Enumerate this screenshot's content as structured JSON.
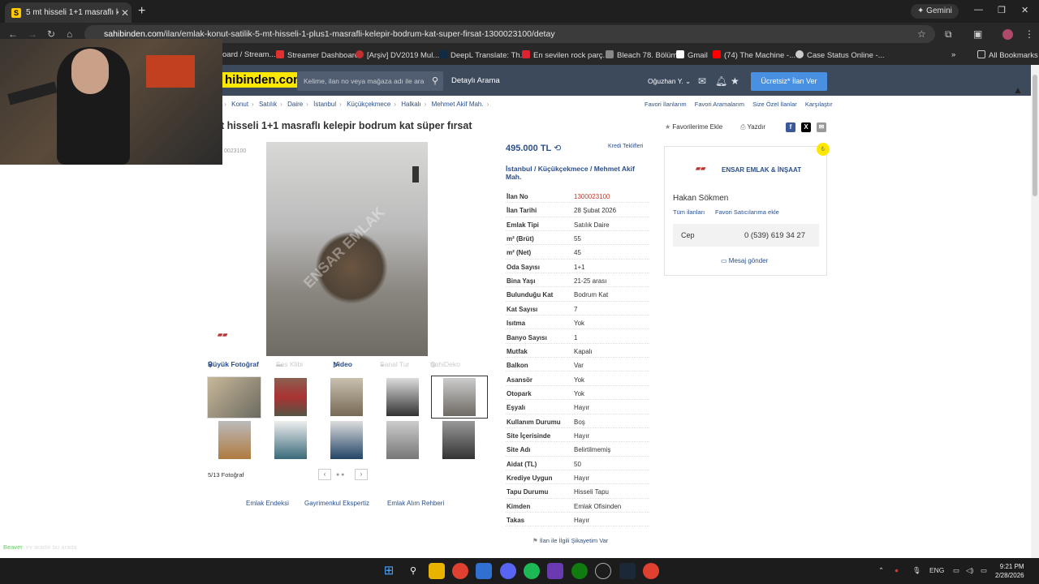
{
  "browser": {
    "tab_title": "5 mt hisseli 1+1 masraflı kelepir",
    "tab_favicon": "S",
    "gemini_label": "Gemini",
    "url_domain": "sahibinden.com",
    "url_path": "/ilan/emlak-konut-satilik-5-mt-hisseli-1-plus1-masrafli-kelepir-bodrum-kat-super-firsat-1300023100/detay",
    "bookmarks": [
      "oard / Stream...",
      "Streamer Dashboard",
      "[Arşiv] DV2019 Mul...",
      "DeepL Translate: Th...",
      "En sevilen rock parç...",
      "Bleach 78. Bölüm",
      "Gmail",
      "(74) The Machine -...",
      "Case Status Online -..."
    ],
    "all_bookmarks": "All Bookmarks"
  },
  "site": {
    "logo": "hibinden.com",
    "search_placeholder": "Kelime, ilan no veya mağaza adı ile ara",
    "detailed_search": "Detaylı Arama",
    "user_name": "Oğuzhan Y.",
    "post_ad": "Ücretsiz* İlan Ver"
  },
  "breadcrumb": [
    "t",
    "Konut",
    "Satılık",
    "Daire",
    "İstanbul",
    "Küçükçekmece",
    "Halkalı",
    "Mehmet Akif Mah."
  ],
  "top_links": [
    "Favori İlanlarım",
    "Favori Aramalarım",
    "Size Özel İlanlar",
    "Karşılaştır"
  ],
  "listing": {
    "title": "t hisseli 1+1 masraflı kelepir bodrum kat süper fırsat",
    "add_favorite": "Favorilerime Ekle",
    "print": "Yazdır",
    "id_side": "0023100",
    "price": "495.000 TL",
    "credit_offers": "Kredi Teklifleri",
    "location": [
      "İstanbul",
      "Küçükçekmece",
      "Mehmet Akif Mah."
    ],
    "details": [
      {
        "k": "İlan No",
        "v": "1300023100"
      },
      {
        "k": "İlan Tarihi",
        "v": "28 Şubat 2026"
      },
      {
        "k": "Emlak Tipi",
        "v": "Satılık Daire"
      },
      {
        "k": "m² (Brüt)",
        "v": "55"
      },
      {
        "k": "m² (Net)",
        "v": "45"
      },
      {
        "k": "Oda Sayısı",
        "v": "1+1"
      },
      {
        "k": "Bina Yaşı",
        "v": "21-25 arası"
      },
      {
        "k": "Bulunduğu Kat",
        "v": "Bodrum Kat"
      },
      {
        "k": "Kat Sayısı",
        "v": "7"
      },
      {
        "k": "Isıtma",
        "v": "Yok"
      },
      {
        "k": "Banyo Sayısı",
        "v": "1"
      },
      {
        "k": "Mutfak",
        "v": "Kapalı"
      },
      {
        "k": "Balkon",
        "v": "Var"
      },
      {
        "k": "Asansör",
        "v": "Yok"
      },
      {
        "k": "Otopark",
        "v": "Yok"
      },
      {
        "k": "Eşyalı",
        "v": "Hayır"
      },
      {
        "k": "Kullanım Durumu",
        "v": "Boş"
      },
      {
        "k": "Site İçerisinde",
        "v": "Hayır"
      },
      {
        "k": "Site Adı",
        "v": "Belirtilmemiş"
      },
      {
        "k": "Aidat (TL)",
        "v": "50"
      },
      {
        "k": "Krediye Uygun",
        "v": "Hayır"
      },
      {
        "k": "Tapu Durumu",
        "v": "Hisseli Tapu"
      },
      {
        "k": "Kimden",
        "v": "Emlak Ofisinden"
      },
      {
        "k": "Takas",
        "v": "Hayır"
      }
    ],
    "complaint": "İlan ile İlgili Şikayetim Var"
  },
  "photos": {
    "tabs": [
      "Büyük Fotoğraf",
      "Ses Klibi",
      "Video",
      "Sanal Tur",
      "SahiDeko"
    ],
    "count": "5/13 Fotoğraf",
    "watermark": "ENSAR EMLAK"
  },
  "under_links": [
    "Emlak Endeksi",
    "Gayrimenkul Ekspertiz",
    "Emlak Alım Rehberi"
  ],
  "seller": {
    "company": "ENSAR EMLAK & İNŞAAT",
    "name": "Hakan Sökmen",
    "all_listings": "Tüm ilanları",
    "add_fav_seller": "Favori Satıcılarıma ekle",
    "phone_label": "Cep",
    "phone": "0 (539) 619 34 27",
    "send_message": "Mesaj gönder"
  },
  "chat": {
    "user": "Beaver",
    "text": ": ev aradık bu arada"
  },
  "taskbar": {
    "lang": "ENG",
    "time": "9:21 PM",
    "date": "2/28/2026"
  }
}
